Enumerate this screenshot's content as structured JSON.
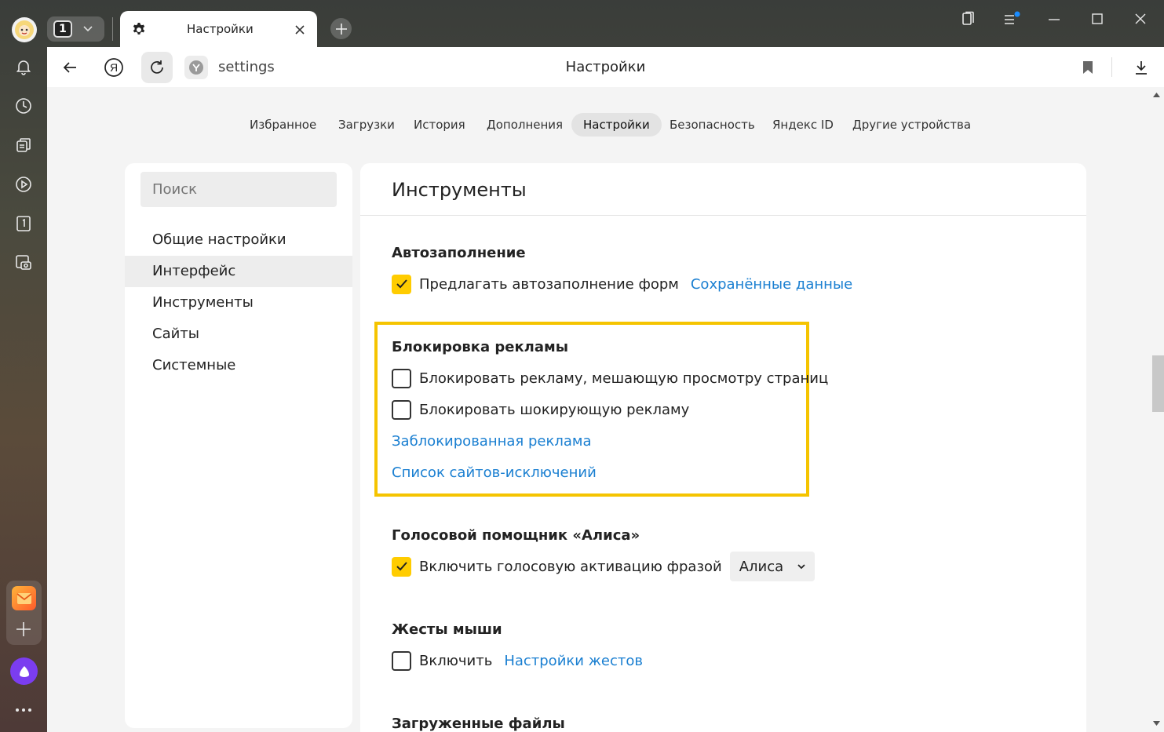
{
  "browser": {
    "tab_count": "1",
    "tab_title": "Настройки",
    "url": "settings",
    "page_title": "Настройки"
  },
  "nav": {
    "items": [
      {
        "label": "Избранное",
        "active": false
      },
      {
        "label": "Загрузки",
        "active": false
      },
      {
        "label": "История",
        "active": false
      },
      {
        "label": "Дополнения",
        "active": false
      },
      {
        "label": "Настройки",
        "active": true
      },
      {
        "label": "Безопасность",
        "active": false
      },
      {
        "label": "Яндекс ID",
        "active": false
      },
      {
        "label": "Другие устройства",
        "active": false
      }
    ]
  },
  "sidebar": {
    "search_placeholder": "Поиск",
    "items": [
      {
        "label": "Общие настройки",
        "active": false
      },
      {
        "label": "Интерфейс",
        "active": true
      },
      {
        "label": "Инструменты",
        "active": false
      },
      {
        "label": "Сайты",
        "active": false
      },
      {
        "label": "Системные",
        "active": false
      }
    ]
  },
  "main": {
    "title": "Инструменты",
    "autofill": {
      "title": "Автозаполнение",
      "option": "Предлагать автозаполнение форм",
      "checked": true,
      "link": "Сохранённые данные"
    },
    "adblock": {
      "title": "Блокировка рекламы",
      "option1": "Блокировать рекламу, мешающую просмотру страниц",
      "option1_checked": false,
      "option2": "Блокировать шокирующую рекламу",
      "option2_checked": false,
      "link1": "Заблокированная реклама",
      "link2": "Список сайтов-исключений"
    },
    "voice": {
      "title": "Голосовой помощник «Алиса»",
      "option": "Включить голосовую активацию фразой",
      "checked": true,
      "select_value": "Алиса"
    },
    "gestures": {
      "title": "Жесты мыши",
      "option": "Включить",
      "checked": false,
      "link": "Настройки жестов"
    },
    "downloads": {
      "title": "Загруженные файлы"
    }
  },
  "colors": {
    "accent_yellow": "#ffcc00",
    "highlight_border": "#f5c400",
    "link": "#1a7fd1"
  }
}
